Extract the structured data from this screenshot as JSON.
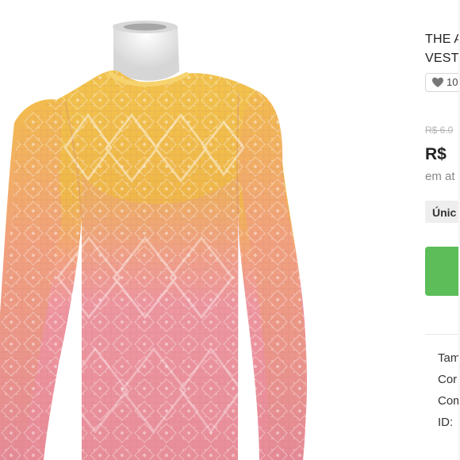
{
  "product": {
    "brand": "THE A",
    "title_fragment": "VEST",
    "like_count": "10",
    "old_price": "R$ 6.0",
    "price_fragment": "R$",
    "installment_fragment": "em at",
    "size_label": "Únic"
  },
  "details": [
    "Tam",
    "Cor",
    "Com",
    "ID:"
  ],
  "colors": {
    "buy_green": "#5cbd59",
    "mannequin": "#e7e7e7",
    "yellow_knit": "#f0b849",
    "pink_knit": "#eb8e99"
  },
  "icons": {
    "heart": "heart-icon"
  }
}
